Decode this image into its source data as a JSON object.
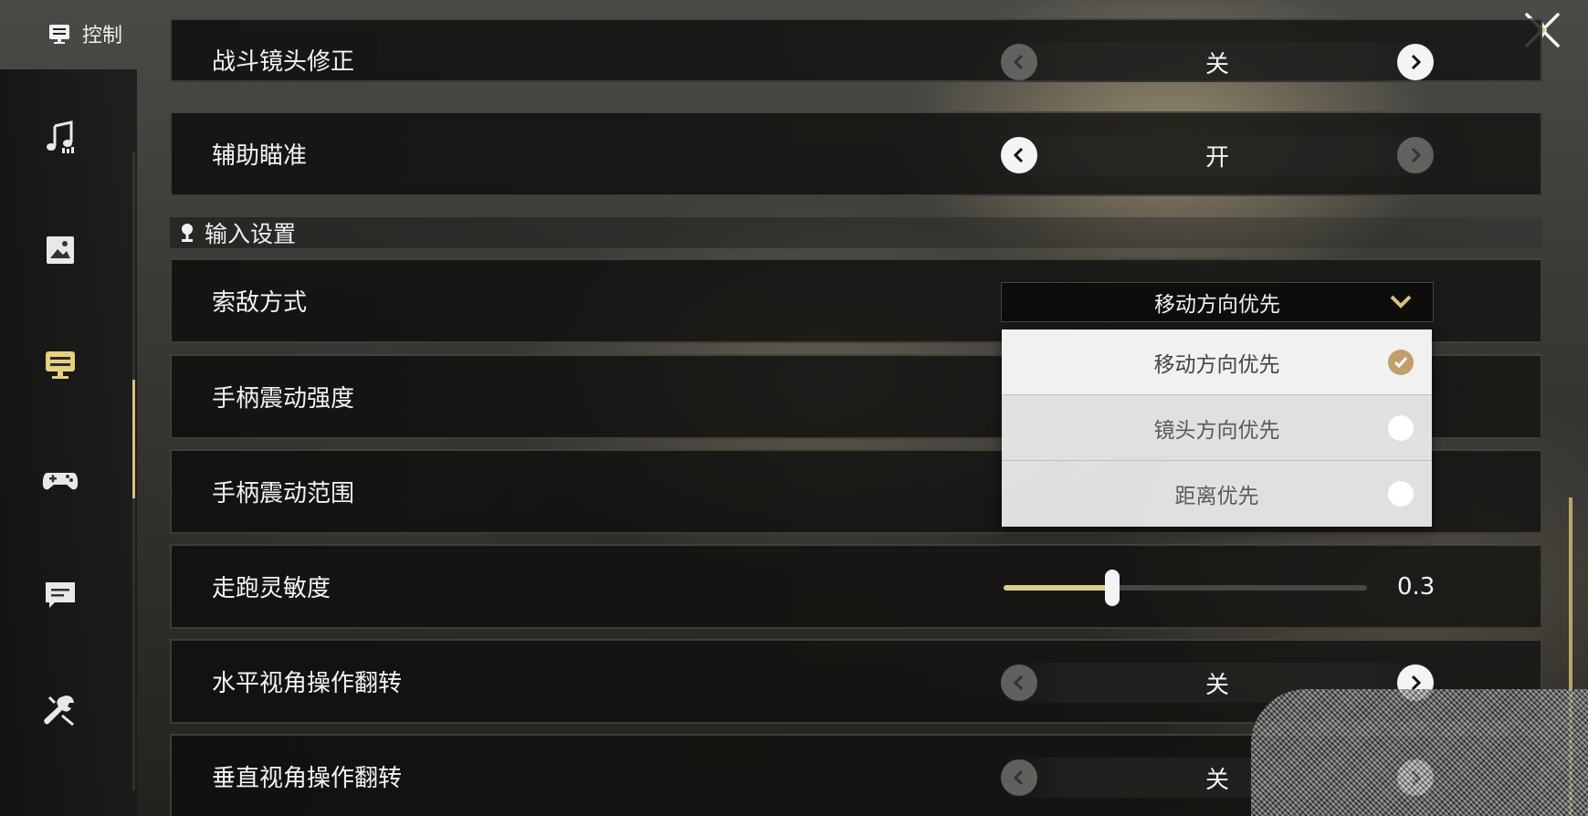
{
  "header": {
    "title": "控制",
    "icon": "controls-icon",
    "close_icon": "close-x-icon"
  },
  "sidebar": {
    "items": [
      {
        "icon": "music-icon",
        "active": false
      },
      {
        "icon": "image-icon",
        "active": false
      },
      {
        "icon": "controls-icon",
        "active": true
      },
      {
        "icon": "gamepad-icon",
        "active": false
      },
      {
        "icon": "chat-icon",
        "active": false
      },
      {
        "icon": "wrench-icon",
        "active": false
      }
    ]
  },
  "settings": {
    "partial_row": {
      "label": "战斗镜头修正",
      "value": "关"
    },
    "aim_assist": {
      "label": "辅助瞄准",
      "value": "开"
    },
    "section_title": "输入设置",
    "targeting": {
      "label": "索敌方式",
      "value": "移动方向优先",
      "options": [
        {
          "label": "移动方向优先",
          "selected": true
        },
        {
          "label": "镜头方向优先",
          "selected": false
        },
        {
          "label": "距离优先",
          "selected": false
        }
      ]
    },
    "vibration_strength": {
      "label": "手柄震动强度"
    },
    "vibration_range": {
      "label": "手柄震动范围"
    },
    "run_sensitivity": {
      "label": "走跑灵敏度",
      "value": "0.3",
      "fraction": 0.3
    },
    "horizontal_invert": {
      "label": "水平视角操作翻转",
      "value": "关"
    },
    "vertical_invert": {
      "label": "垂直视角操作翻转",
      "value": "关"
    }
  },
  "colors": {
    "accent": "#d9c27a",
    "check": "#c0a06a",
    "slider_fill": "#d9cc8e"
  }
}
